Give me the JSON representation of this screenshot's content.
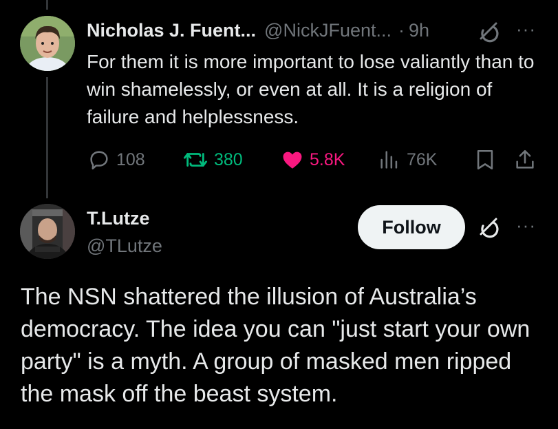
{
  "tweet1": {
    "author_name": "Nicholas J. Fuent...",
    "handle": "@NickJFuent...",
    "separator": "·",
    "time": "9h",
    "text": "For them it is more important to lose valiantly than to win shamelessly, or even at all. It is a religion of failure and helplessness.",
    "stats": {
      "replies": "108",
      "reposts": "380",
      "likes": "5.8K",
      "views": "76K"
    },
    "more_label": "···"
  },
  "tweet2": {
    "author_name": "T.Lutze",
    "handle": "@TLutze",
    "follow_label": "Follow",
    "more_label": "···",
    "text": "The NSN shattered the illusion of Australia’s democracy. The idea you can \"just start your own party\" is a myth. A group of masked men ripped the mask off the beast system."
  },
  "colors": {
    "background": "#000000",
    "text": "#e7e9ea",
    "muted": "#71767b",
    "repost": "#00ba7c",
    "like": "#f91880",
    "follow_bg": "#eff3f4"
  },
  "icons": [
    "reply-icon",
    "repost-icon",
    "like-icon",
    "views-icon",
    "bookmark-icon",
    "share-icon",
    "grok-icon",
    "more-icon"
  ]
}
